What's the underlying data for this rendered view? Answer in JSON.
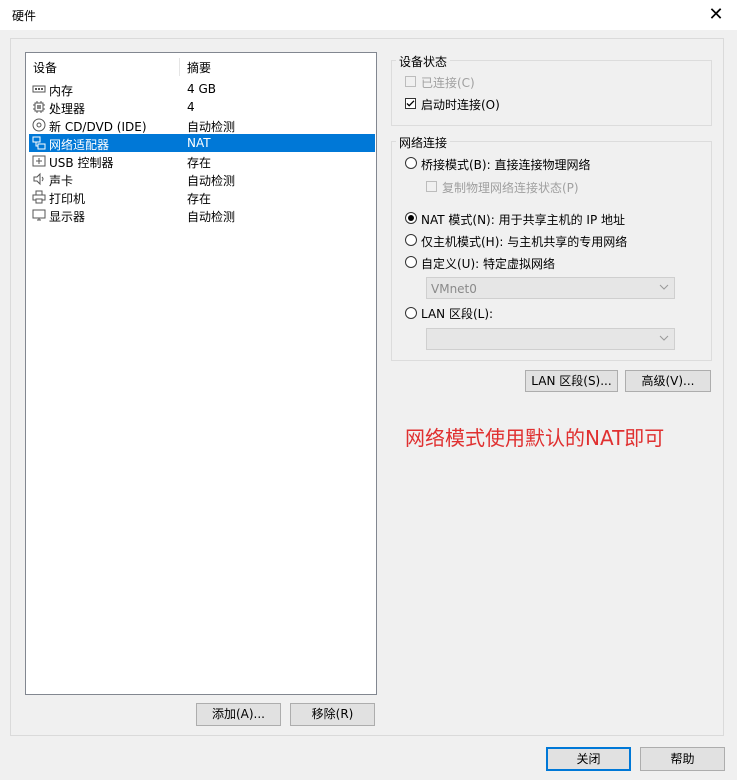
{
  "window": {
    "title": "硬件",
    "close_symbol": "✕"
  },
  "device_list": {
    "col_device": "设备",
    "col_summary": "摘要",
    "items": [
      {
        "name": "内存",
        "summary": "4 GB",
        "icon": "memory-icon"
      },
      {
        "name": "处理器",
        "summary": "4",
        "icon": "processor-icon"
      },
      {
        "name": "新 CD/DVD (IDE)",
        "summary": "自动检测",
        "icon": "cd-dvd-icon"
      },
      {
        "name": "网络适配器",
        "summary": "NAT",
        "icon": "network-adapter-icon",
        "selected": true
      },
      {
        "name": "USB 控制器",
        "summary": "存在",
        "icon": "usb-icon"
      },
      {
        "name": "声卡",
        "summary": "自动检测",
        "icon": "speaker-icon"
      },
      {
        "name": "打印机",
        "summary": "存在",
        "icon": "printer-icon"
      },
      {
        "name": "显示器",
        "summary": "自动检测",
        "icon": "monitor-icon"
      }
    ],
    "add_button": "添加(A)...",
    "remove_button": "移除(R)"
  },
  "device_status": {
    "title": "设备状态",
    "connected_label": "已连接(C)",
    "connected": false,
    "connect_at_power_on_label": "启动时连接(O)",
    "connect_at_power_on": true
  },
  "network_connection": {
    "title": "网络连接",
    "bridged_label": "桥接模式(B): 直接连接物理网络",
    "replicate_label": "复制物理网络连接状态(P)",
    "nat_label": "NAT 模式(N): 用于共享主机的 IP 地址",
    "host_only_label": "仅主机模式(H): 与主机共享的专用网络",
    "custom_label": "自定义(U): 特定虚拟网络",
    "custom_value": "VMnet0",
    "lan_label": "LAN 区段(L):",
    "lan_value": "",
    "selected": "nat"
  },
  "buttons": {
    "lan_segments": "LAN 区段(S)...",
    "advanced": "高级(V)...",
    "close": "关闭",
    "help": "帮助"
  },
  "annotation": "网络模式使用默认的NAT即可",
  "colors": {
    "selection": "#0078d7",
    "annotation": "#e03030"
  }
}
